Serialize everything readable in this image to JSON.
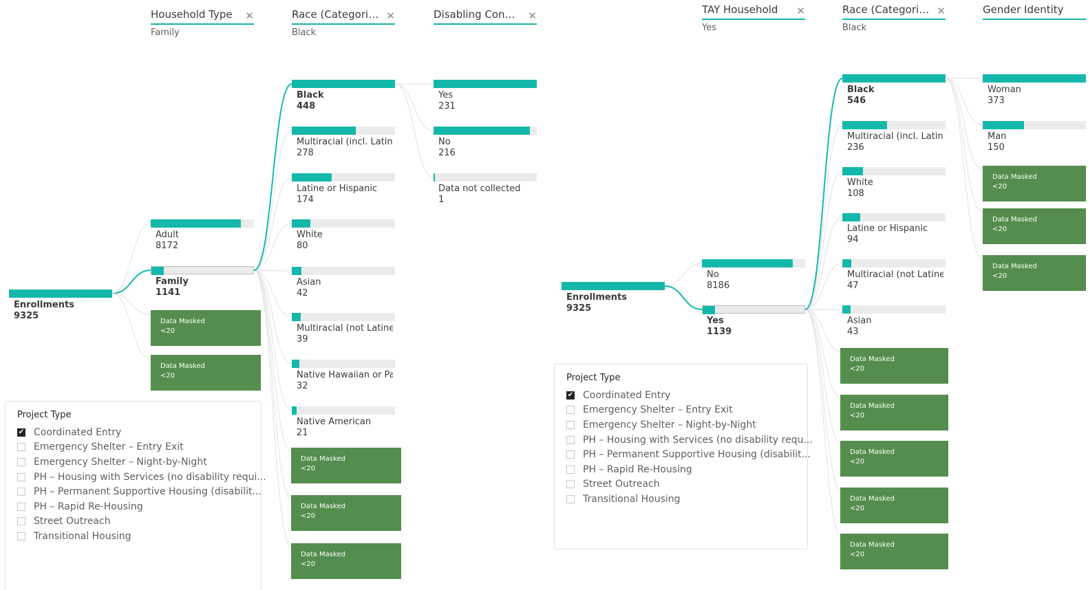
{
  "colors": {
    "accent": "#14b8ab",
    "masked": "#548d4d",
    "track": "#ebebeb"
  },
  "masked_label": "Data Masked",
  "masked_value": "<20",
  "left": {
    "columns": [
      {
        "title": "Household Type",
        "selected": "Family"
      },
      {
        "title": "Race (Categorized)",
        "selected": "Black"
      },
      {
        "title": "Disabling Condit...",
        "selected": ""
      }
    ],
    "root": {
      "label": "Enrollments",
      "value": "9325"
    },
    "level1": [
      {
        "label": "Adult",
        "value": "8172"
      },
      {
        "label": "Family",
        "value": "1141"
      }
    ],
    "level2": [
      {
        "label": "Black",
        "value": "448"
      },
      {
        "label": "Multiracial (incl. Latine...",
        "value": "278"
      },
      {
        "label": "Latine or Hispanic",
        "value": "174"
      },
      {
        "label": "White",
        "value": "80"
      },
      {
        "label": "Asian",
        "value": "42"
      },
      {
        "label": "Multiracial (not Latine ...",
        "value": "39"
      },
      {
        "label": "Native Hawaiian or Pa...",
        "value": "32"
      },
      {
        "label": "Native American",
        "value": "21"
      }
    ],
    "level3": [
      {
        "label": "Yes",
        "value": "231"
      },
      {
        "label": "No",
        "value": "216"
      },
      {
        "label": "Data not collected",
        "value": "1"
      }
    ],
    "slicer": {
      "title": "Project Type",
      "items": [
        {
          "label": "Coordinated Entry",
          "checked": true
        },
        {
          "label": "Emergency Shelter – Entry Exit",
          "checked": false
        },
        {
          "label": "Emergency Shelter – Night-by-Night",
          "checked": false
        },
        {
          "label": "PH – Housing with Services (no disability requi...",
          "checked": false
        },
        {
          "label": "PH – Permanent Supportive Housing (disabilit...",
          "checked": false
        },
        {
          "label": "PH – Rapid Re-Housing",
          "checked": false
        },
        {
          "label": "Street Outreach",
          "checked": false
        },
        {
          "label": "Transitional Housing",
          "checked": false
        }
      ]
    }
  },
  "right": {
    "columns": [
      {
        "title": "TAY Household",
        "selected": "Yes"
      },
      {
        "title": "Race (Categorized)",
        "selected": "Black"
      },
      {
        "title": "Gender Identity",
        "selected": ""
      }
    ],
    "root": {
      "label": "Enrollments",
      "value": "9325"
    },
    "level1": [
      {
        "label": "No",
        "value": "8186"
      },
      {
        "label": "Yes",
        "value": "1139"
      }
    ],
    "level2": [
      {
        "label": "Black",
        "value": "546"
      },
      {
        "label": "Multiracial (incl. Latine...",
        "value": "236"
      },
      {
        "label": "White",
        "value": "108"
      },
      {
        "label": "Latine or Hispanic",
        "value": "94"
      },
      {
        "label": "Multiracial (not Latine ...",
        "value": "47"
      },
      {
        "label": "Asian",
        "value": "43"
      }
    ],
    "level3": [
      {
        "label": "Woman",
        "value": "373"
      },
      {
        "label": "Man",
        "value": "150"
      }
    ],
    "slicer": {
      "title": "Project Type",
      "items": [
        {
          "label": "Coordinated Entry",
          "checked": true
        },
        {
          "label": "Emergency Shelter – Entry Exit",
          "checked": false
        },
        {
          "label": "Emergency Shelter – Night-by-Night",
          "checked": false
        },
        {
          "label": "PH – Housing with Services (no disability requ...",
          "checked": false
        },
        {
          "label": "PH – Permanent Supportive Housing (disabilit...",
          "checked": false
        },
        {
          "label": "PH – Rapid Re-Housing",
          "checked": false
        },
        {
          "label": "Street Outreach",
          "checked": false
        },
        {
          "label": "Transitional Housing",
          "checked": false
        }
      ]
    }
  }
}
